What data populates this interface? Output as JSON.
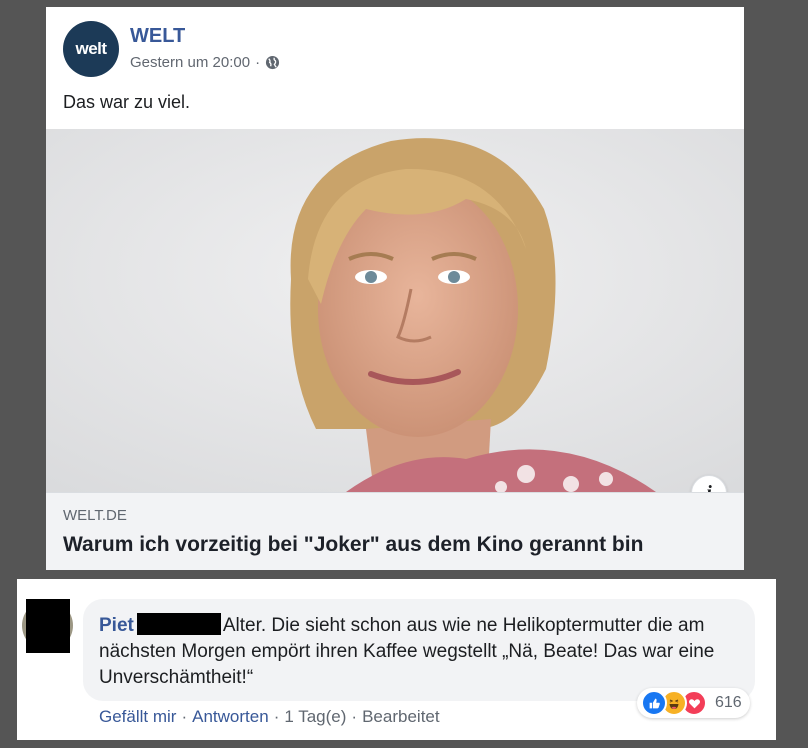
{
  "post": {
    "logo_text": "welt",
    "page_name": "WELT",
    "timestamp": "Gestern um 20:00",
    "separator": "·",
    "privacy_icon": "globe-icon",
    "text": "Das war zu viel.",
    "link": {
      "domain": "WELT.DE",
      "title": "Warum ich vorzeitig bei \"Joker\" aus dem Kino gerannt bin",
      "info_icon": "info-icon",
      "info_label": "i"
    }
  },
  "comment": {
    "author": "Piet",
    "text": "Alter. Die sieht schon aus wie ne Helikoptermutter die am nächsten Morgen empört ihren Kaffee wegstellt „Nä, Beate! Das war eine Unverschämtheit!“",
    "reactions": {
      "icons": [
        "like-icon",
        "haha-icon",
        "love-icon"
      ],
      "count": "616"
    },
    "actions": {
      "like": "Gefällt mir",
      "reply": "Antworten",
      "time": "1 Tag(e)",
      "edited": "Bearbeitet",
      "dot": "·"
    }
  },
  "colors": {
    "background": "#555555",
    "link_blue": "#385898",
    "welt_logo_bg": "#1c3a57",
    "like": "#1877f2",
    "haha": "#f7b125",
    "love": "#f33e58"
  }
}
